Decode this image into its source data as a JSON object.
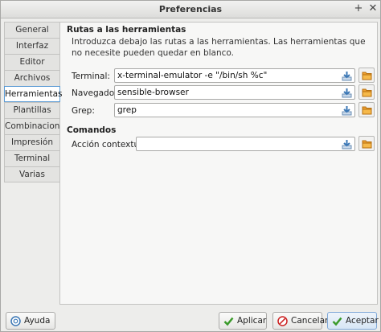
{
  "window": {
    "title": "Preferencias"
  },
  "tabs": [
    {
      "label": "General"
    },
    {
      "label": "Interfaz"
    },
    {
      "label": "Editor"
    },
    {
      "label": "Archivos"
    },
    {
      "label": "Herramientas",
      "active": true
    },
    {
      "label": "Plantillas"
    },
    {
      "label": "Combinaciones"
    },
    {
      "label": "Impresión"
    },
    {
      "label": "Terminal"
    },
    {
      "label": "Varias"
    }
  ],
  "tools": {
    "heading": "Rutas a las herramientas",
    "description": "Introduzca debajo las rutas a las herramientas. Las herramientas que no necesite pueden quedar en blanco.",
    "terminal": {
      "label": "Terminal:",
      "value": "x-terminal-emulator -e \"/bin/sh %c\""
    },
    "browser": {
      "label": "Navegador:",
      "value": "sensible-browser"
    },
    "grep": {
      "label": "Grep:",
      "value": "grep"
    }
  },
  "commands": {
    "heading": "Comandos",
    "context_action": {
      "label": "Acción contextual:",
      "value": ""
    }
  },
  "footer": {
    "help": "Ayuda",
    "apply": "Aplicar",
    "cancel": "Cancelar",
    "accept": "Aceptar"
  },
  "colors": {
    "accent": "#5b9bd5",
    "folder": "#f0a030",
    "apply_check": "#3a9a2a",
    "cancel_x": "#cc2222"
  },
  "icons": {
    "field_action": "insert-into-field-icon",
    "browse": "open-folder-icon"
  }
}
